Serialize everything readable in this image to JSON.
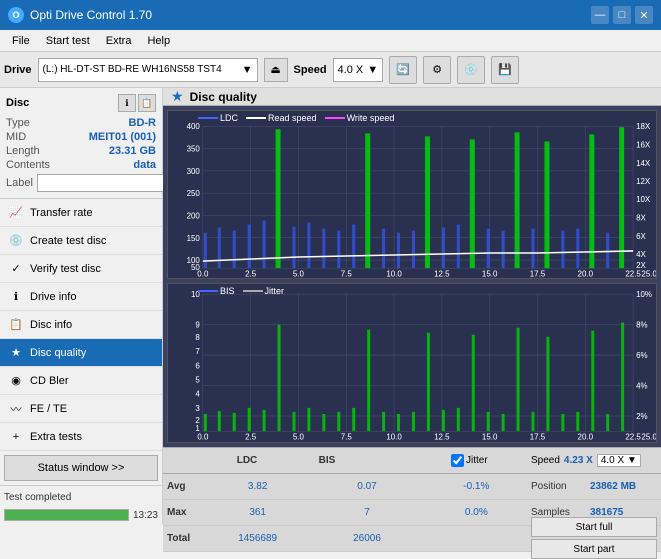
{
  "titlebar": {
    "title": "Opti Drive Control 1.70",
    "logo": "O",
    "minimize": "—",
    "maximize": "□",
    "close": "✕"
  },
  "menubar": {
    "items": [
      "File",
      "Start test",
      "Extra",
      "Help"
    ]
  },
  "drivebar": {
    "drive_label": "Drive",
    "drive_value": "(L:)  HL-DT-ST BD-RE  WH16NS58 TST4",
    "speed_label": "Speed",
    "speed_value": "4.0 X"
  },
  "disc": {
    "title": "Disc",
    "type_label": "Type",
    "type_value": "BD-R",
    "mid_label": "MID",
    "mid_value": "MEIT01 (001)",
    "length_label": "Length",
    "length_value": "23.31 GB",
    "contents_label": "Contents",
    "contents_value": "data",
    "label_label": "Label"
  },
  "nav": {
    "items": [
      {
        "id": "transfer-rate",
        "label": "Transfer rate",
        "icon": "📈"
      },
      {
        "id": "create-test-disc",
        "label": "Create test disc",
        "icon": "💿"
      },
      {
        "id": "verify-test-disc",
        "label": "Verify test disc",
        "icon": "✓"
      },
      {
        "id": "drive-info",
        "label": "Drive info",
        "icon": "ℹ"
      },
      {
        "id": "disc-info",
        "label": "Disc info",
        "icon": "📋"
      },
      {
        "id": "disc-quality",
        "label": "Disc quality",
        "icon": "★",
        "active": true
      },
      {
        "id": "cd-bler",
        "label": "CD Bler",
        "icon": "◉"
      },
      {
        "id": "fe-te",
        "label": "FE / TE",
        "icon": "〰"
      },
      {
        "id": "extra-tests",
        "label": "Extra tests",
        "icon": "+"
      }
    ]
  },
  "status": {
    "text": "Test completed",
    "progress": 100,
    "time": "13:23"
  },
  "content": {
    "title": "Disc quality",
    "icon": "★"
  },
  "chart1": {
    "legend": [
      {
        "label": "LDC",
        "color": "#4444ff"
      },
      {
        "label": "Read speed",
        "color": "#ffffff"
      },
      {
        "label": "Write speed",
        "color": "#ff44ff"
      }
    ],
    "y_max": 400,
    "x_max": 25,
    "right_labels": [
      "18X",
      "16X",
      "14X",
      "12X",
      "10X",
      "8X",
      "6X",
      "4X",
      "2X"
    ]
  },
  "chart2": {
    "legend": [
      {
        "label": "BIS",
        "color": "#4444ff"
      },
      {
        "label": "Jitter",
        "color": "#888888"
      }
    ],
    "y_max": 10,
    "x_max": 25,
    "right_labels": [
      "10%",
      "8%",
      "6%",
      "4%",
      "2%"
    ]
  },
  "stats": {
    "headers": [
      "LDC",
      "BIS",
      "",
      "Jitter",
      "Speed"
    ],
    "jitter_label": "Jitter",
    "speed_label": "Speed",
    "speed_actual": "4.23 X",
    "speed_set": "4.0 X",
    "rows": [
      {
        "label": "Avg",
        "ldc": "3.82",
        "bis": "0.07",
        "jitter": "-0.1%"
      },
      {
        "label": "Max",
        "ldc": "361",
        "bis": "7",
        "jitter": "0.0%"
      },
      {
        "label": "Total",
        "ldc": "1456689",
        "bis": "26006",
        "jitter": ""
      }
    ],
    "position_label": "Position",
    "position_value": "23862 MB",
    "samples_label": "Samples",
    "samples_value": "381675",
    "start_full_label": "Start full",
    "start_part_label": "Start part"
  }
}
